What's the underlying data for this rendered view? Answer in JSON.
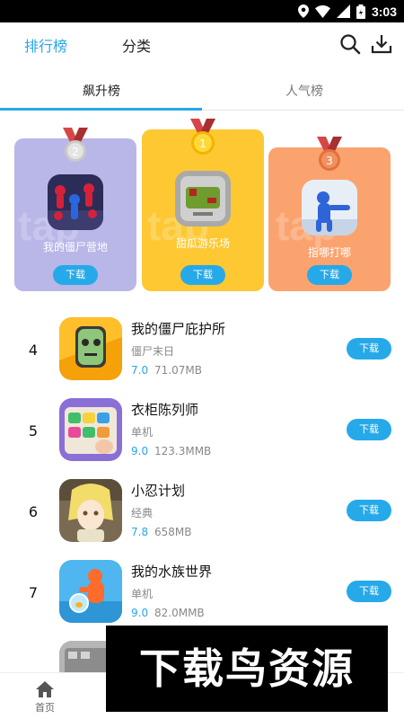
{
  "status_bar": {
    "time": "3:03"
  },
  "header": {
    "tab_ranking": "排行榜",
    "tab_category": "分类"
  },
  "subtabs": {
    "rising": "飙升榜",
    "popular": "人气榜"
  },
  "podium": [
    {
      "rank": "2",
      "title": "我的僵尸营地",
      "button": "下载"
    },
    {
      "rank": "1",
      "title": "甜瓜游乐场",
      "button": "下载"
    },
    {
      "rank": "3",
      "title": "指哪打哪",
      "button": "下载"
    }
  ],
  "watermark_letters": "tap",
  "list": [
    {
      "rank": "4",
      "name": "我的僵尸庇护所",
      "category": "僵尸末日",
      "score": "7.0",
      "size": "71.07MB",
      "button": "下载"
    },
    {
      "rank": "5",
      "name": "衣柜陈列师",
      "category": "单机",
      "score": "9.0",
      "size": "123.3MMB",
      "button": "下载"
    },
    {
      "rank": "6",
      "name": "小忍计划",
      "category": "经典",
      "score": "7.8",
      "size": "658MB",
      "button": "下载"
    },
    {
      "rank": "7",
      "name": "我的水族世界",
      "category": "单机",
      "score": "9.0",
      "size": "82.0MMB",
      "button": "下载"
    }
  ],
  "bottom_nav": {
    "home": "首页"
  },
  "banner_text": "下载鸟资源",
  "colors": {
    "accent": "#27a7e7",
    "button": "#26a9e9",
    "gold": "#fdc832",
    "silver_card": "#b9b6e8",
    "bronze_card": "#fba36f"
  }
}
